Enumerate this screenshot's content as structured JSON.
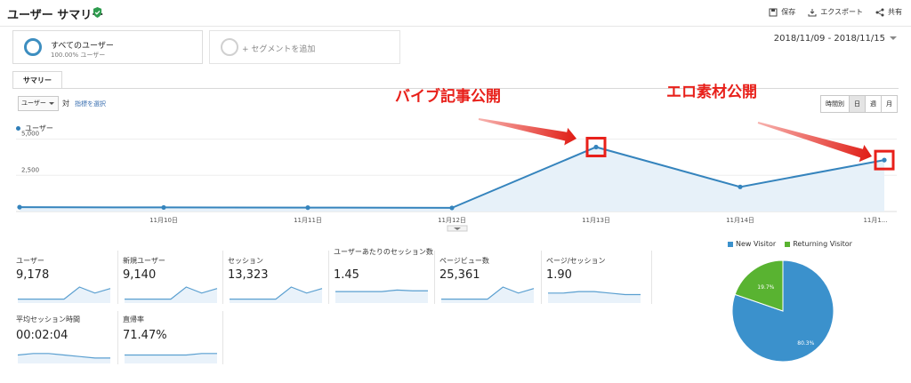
{
  "header": {
    "title": "ユーザー サマリー",
    "actions": {
      "save": "保存",
      "export": "エクスポート",
      "share": "共有"
    }
  },
  "segments": {
    "primary": {
      "title": "すべてのユーザー",
      "subtitle": "100.00% ユーザー"
    },
    "add_label": "+ セグメントを追加"
  },
  "date_range": "2018/11/09 - 2018/11/15",
  "tabs": [
    {
      "label": "サマリー"
    }
  ],
  "controls": {
    "metric": "ユーザー",
    "vs": "対",
    "select_metric": "指標を選択",
    "granularity": [
      {
        "label": "時間別",
        "active": false
      },
      {
        "label": "日",
        "active": true
      },
      {
        "label": "週",
        "active": false
      },
      {
        "label": "月",
        "active": false
      }
    ]
  },
  "annotations": {
    "first": "バイブ記事公開",
    "second": "エロ素材公開"
  },
  "colors": {
    "line": "#3584bd",
    "fill": "#e7f1f9",
    "annotation": "#e8201a",
    "new_visitor": "#3b91cc",
    "returning_visitor": "#59b331"
  },
  "chart_data": [
    {
      "type": "area",
      "series": [
        {
          "name": "ユーザー",
          "values": [
            300,
            280,
            270,
            250,
            4450,
            1700,
            3550
          ]
        }
      ],
      "x": [
        "11月9日",
        "11月10日",
        "11月11日",
        "11月12日",
        "11月13日",
        "11月14日",
        "11月15日"
      ],
      "x_tick_labels": [
        "11月10日",
        "11月11日",
        "11月12日",
        "11月13日",
        "11月14日",
        "11月1..."
      ],
      "y_ticks": [
        "5,000",
        "2,500"
      ],
      "ylim": [
        0,
        5400
      ],
      "grid": true,
      "legend": "top-left"
    },
    {
      "type": "pie",
      "slices": [
        {
          "name": "New Visitor",
          "value": 80.3,
          "label": "80.3%"
        },
        {
          "name": "Returning Visitor",
          "value": 19.7,
          "label": "19.7%"
        }
      ],
      "legend": "top"
    }
  ],
  "metrics": [
    {
      "label": "ユーザー",
      "value": "9,178",
      "spark": [
        2,
        2,
        2,
        2,
        10,
        6,
        9
      ]
    },
    {
      "label": "新規ユーザー",
      "value": "9,140",
      "spark": [
        2,
        2,
        2,
        2,
        10,
        6,
        9
      ]
    },
    {
      "label": "セッション",
      "value": "13,323",
      "spark": [
        2,
        2,
        2,
        2,
        10,
        6,
        9
      ]
    },
    {
      "label": "ユーザーあたりのセッション数",
      "value": "1.45",
      "spark": [
        7,
        7,
        7,
        7,
        8,
        7.5,
        7.5
      ]
    },
    {
      "label": "ページビュー数",
      "value": "25,361",
      "spark": [
        2,
        2,
        2,
        2,
        10,
        6,
        9
      ]
    },
    {
      "label": "ページ/セッション",
      "value": "1.90",
      "spark": [
        6,
        6,
        7,
        7,
        6,
        5,
        5
      ]
    },
    {
      "label": "平均セッション時間",
      "value": "00:02:04",
      "spark": [
        5,
        6,
        6,
        5,
        4,
        3,
        3
      ]
    },
    {
      "label": "直帰率",
      "value": "71.47%",
      "spark": [
        5,
        5,
        5,
        5,
        5,
        6,
        6
      ]
    }
  ]
}
